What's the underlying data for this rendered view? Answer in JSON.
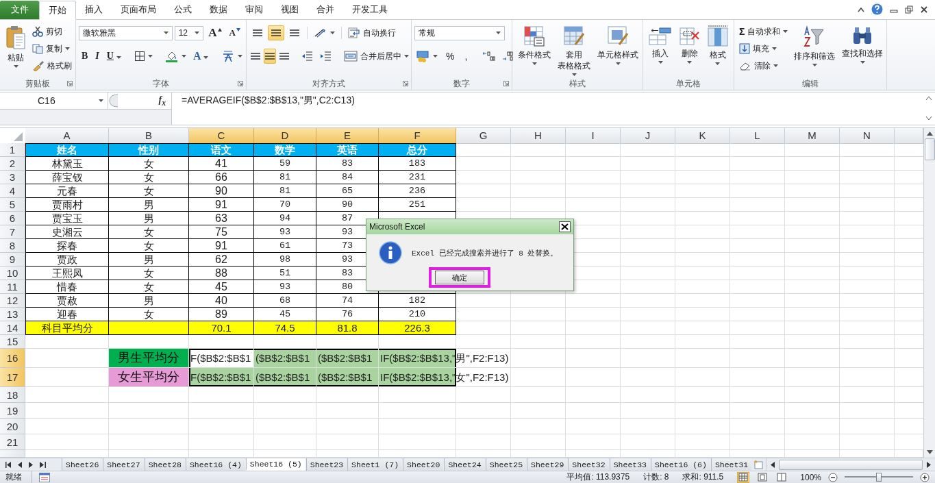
{
  "menu_tabs": [
    {
      "label": "文件",
      "kind": "file",
      "selected": false
    },
    {
      "label": "开始",
      "kind": "tab",
      "selected": true
    },
    {
      "label": "插入",
      "kind": "tab",
      "selected": false
    },
    {
      "label": "页面布局",
      "kind": "tab",
      "selected": false
    },
    {
      "label": "公式",
      "kind": "tab",
      "selected": false
    },
    {
      "label": "数据",
      "kind": "tab",
      "selected": false
    },
    {
      "label": "审阅",
      "kind": "tab",
      "selected": false
    },
    {
      "label": "视图",
      "kind": "tab",
      "selected": false
    },
    {
      "label": "合并",
      "kind": "tab",
      "selected": false
    },
    {
      "label": "开发工具",
      "kind": "tab",
      "selected": false
    }
  ],
  "ribbon": {
    "groups": [
      {
        "kind": "clipboard",
        "label": "剪贴板",
        "launcher": true,
        "large": [
          {
            "lines": [
              "粘贴"
            ]
          }
        ],
        "small": [
          {
            "label": "剪切"
          },
          {
            "label": "复制"
          },
          {
            "label": "格式刷"
          }
        ]
      },
      {
        "kind": "font",
        "label": "字体",
        "launcher": true,
        "font_name": "微软雅黑",
        "font_size": "12",
        "grow": "A",
        "shrink": "A",
        "bold": "B",
        "italic": "I",
        "underline": "U",
        "font_color": "A"
      },
      {
        "kind": "alignment",
        "label": "对齐方式",
        "launcher": true,
        "vertical": [
          {
            "selected": false
          },
          {
            "selected": true
          },
          {
            "selected": false
          }
        ],
        "horizontal": [
          {
            "selected": false
          },
          {
            "selected": true
          },
          {
            "selected": false
          }
        ],
        "wrap": "自动换行",
        "merge": "合并后居中"
      },
      {
        "kind": "number",
        "label": "数字",
        "launcher": true,
        "format": "常规",
        "percent": "%",
        "comma": ","
      },
      {
        "kind": "styles",
        "label": "样式",
        "launcher": false,
        "large": [
          {
            "lines": [
              "条件格式"
            ]
          },
          {
            "lines": [
              "套用",
              "表格格式"
            ]
          },
          {
            "lines": [
              "单元格样式"
            ]
          }
        ]
      },
      {
        "kind": "cells",
        "label": "单元格",
        "launcher": false,
        "large": [
          {
            "lines": [
              "插入"
            ]
          },
          {
            "lines": [
              "删除"
            ]
          },
          {
            "lines": [
              "格式"
            ]
          }
        ]
      },
      {
        "kind": "editing",
        "label": "编辑",
        "launcher": false,
        "small": [
          {
            "label": "自动求和",
            "symbol": "Σ"
          },
          {
            "label": "填充"
          },
          {
            "label": "清除"
          }
        ],
        "large": [
          {
            "lines": [
              "排序和筛选"
            ]
          },
          {
            "lines": [
              "查找和选择"
            ]
          }
        ]
      }
    ]
  },
  "formula_bar": {
    "name_box": "C16",
    "function_label": "f$_{x}$",
    "formula": "=AVERAGEIF($B$2:$B$13,\"男\",C2:C13)"
  },
  "sheet": {
    "columns": [
      "A",
      "B",
      "C",
      "D",
      "E",
      "F",
      "G",
      "H",
      "I",
      "J",
      "K",
      "L",
      "M",
      "N"
    ],
    "rows": [
      {
        "number": "1",
        "kind": "header",
        "cells": [
          "姓名",
          "性别",
          "语文",
          "数学",
          "英语",
          "总分"
        ]
      },
      {
        "number": "2",
        "kind": "data",
        "cells": [
          "林黛玉",
          "女",
          "41",
          "59",
          "83",
          "183"
        ]
      },
      {
        "number": "3",
        "kind": "data",
        "cells": [
          "薛宝钗",
          "女",
          "66",
          "81",
          "84",
          "231"
        ]
      },
      {
        "number": "4",
        "kind": "data",
        "cells": [
          "元春",
          "女",
          "90",
          "81",
          "65",
          "236"
        ]
      },
      {
        "number": "5",
        "kind": "data",
        "cells": [
          "贾雨村",
          "男",
          "91",
          "70",
          "90",
          "251"
        ]
      },
      {
        "number": "6",
        "kind": "data",
        "cells": [
          "贾宝玉",
          "男",
          "63",
          "94",
          "87"
        ]
      },
      {
        "number": "7",
        "kind": "data",
        "cells": [
          "史湘云",
          "女",
          "75",
          "93",
          "93"
        ]
      },
      {
        "number": "8",
        "kind": "data",
        "cells": [
          "探春",
          "女",
          "91",
          "61",
          "73"
        ]
      },
      {
        "number": "9",
        "kind": "data",
        "cells": [
          "贾政",
          "男",
          "62",
          "98",
          "93"
        ]
      },
      {
        "number": "10",
        "kind": "data",
        "cells": [
          "王熙凤",
          "女",
          "88",
          "51",
          "83"
        ]
      },
      {
        "number": "11",
        "kind": "data",
        "cells": [
          "惜春",
          "女",
          "45",
          "93",
          "80"
        ]
      },
      {
        "number": "12",
        "kind": "data",
        "cells": [
          "贾赦",
          "男",
          "40",
          "68",
          "74",
          "182"
        ]
      },
      {
        "number": "13",
        "kind": "data",
        "cells": [
          "迎春",
          "女",
          "89",
          "45",
          "76",
          "210"
        ]
      },
      {
        "number": "14",
        "kind": "average",
        "label": "科目平均分",
        "values": [
          "70.1",
          "74.5",
          "81.8",
          "226.3"
        ]
      },
      {
        "number": "15",
        "kind": "blank"
      },
      {
        "number": "16",
        "kind": "formula",
        "label": "男生平均分",
        "color": "#00b050",
        "cells": [
          {
            "text": "F($B$2:$B$1",
            "selected": true,
            "active": true
          },
          {
            "text": "($B$2:$B$1",
            "selected": true,
            "active": false
          },
          {
            "text": "($B$2:$B$1",
            "selected": true,
            "active": false
          },
          {
            "text": "IF($B$2:$B$13,\"男\",F2:F13)",
            "selected": true,
            "active": false
          }
        ]
      },
      {
        "number": "17",
        "kind": "formula",
        "label": "女生平均分",
        "color": "#e69ad6",
        "cells": [
          {
            "text": "F($B$2:$B$1",
            "selected": true,
            "active": false
          },
          {
            "text": "($B$2:$B$1",
            "selected": true,
            "active": false
          },
          {
            "text": "($B$2:$B$1",
            "selected": true,
            "active": false
          },
          {
            "text": "IF($B$2:$B$13,\"女\",F2:F13)",
            "selected": true,
            "active": false
          }
        ]
      },
      {
        "number": "18",
        "kind": "blank"
      },
      {
        "number": "19",
        "kind": "blank"
      },
      {
        "number": "20",
        "kind": "blank"
      },
      {
        "number": "21",
        "kind": "blank"
      }
    ]
  },
  "dialog": {
    "title": "Microsoft Excel",
    "message": "Excel 已经完成搜索并进行了 8 处替换。",
    "ok_button": "确定",
    "highlighted": true
  },
  "sheet_tabs": [
    {
      "label": "Sheet26",
      "selected": false
    },
    {
      "label": "Sheet27",
      "selected": false
    },
    {
      "label": "Sheet28",
      "selected": false
    },
    {
      "label": "Sheet16 (4)",
      "selected": false
    },
    {
      "label": "Sheet16 (5)",
      "selected": true
    },
    {
      "label": "Sheet23",
      "selected": false
    },
    {
      "label": "Sheet1 (7)",
      "selected": false
    },
    {
      "label": "Sheet20",
      "selected": false
    },
    {
      "label": "Sheet24",
      "selected": false
    },
    {
      "label": "Sheet25",
      "selected": false
    },
    {
      "label": "Sheet29",
      "selected": false
    },
    {
      "label": "Sheet32",
      "selected": false
    },
    {
      "label": "Sheet33",
      "selected": false
    },
    {
      "label": "Sheet16 (6)",
      "selected": false
    },
    {
      "label": "Sheet31",
      "selected": false
    }
  ],
  "status_bar": {
    "mode": "就绪",
    "average": "平均值: 113.9375",
    "count": "计数: 8",
    "sum": "求和: 911.5",
    "views": [
      {
        "selected": true
      },
      {
        "selected": false
      },
      {
        "selected": false
      }
    ],
    "zoom": {
      "label": "100%",
      "level": 0.5
    }
  }
}
